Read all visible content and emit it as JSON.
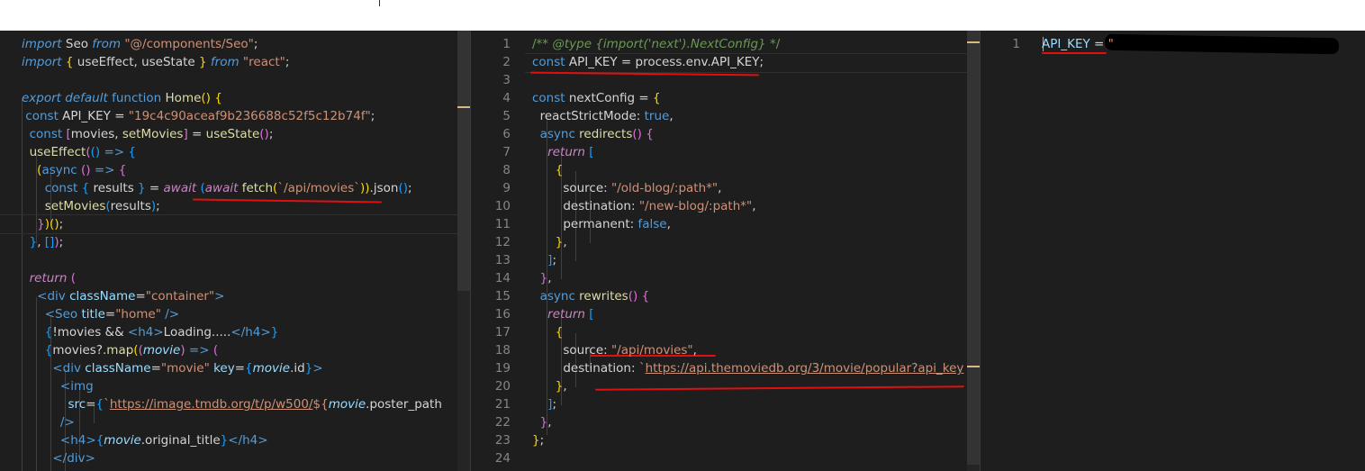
{
  "colors": {
    "background": "#1e1e1e",
    "plain": "#d4d4d4",
    "keyword": "#569cd6",
    "control": "#c586c0",
    "function": "#dcdcaa",
    "string": "#ce9178",
    "variable": "#9cdcfe",
    "comment": "#6a9955",
    "line_number": "#858585",
    "annotation": "#e01010"
  },
  "panes": [
    {
      "name": "index-js",
      "show_line_numbers": false,
      "lines": [
        [
          [
            "kw it",
            "import"
          ],
          [
            "",
            "",
            " Seo "
          ],
          [
            "kw it",
            "from"
          ],
          [
            "",
            " "
          ],
          [
            "str",
            "\"@/components/Seo\""
          ],
          [
            "",
            ";"
          ]
        ],
        [
          [
            "kw it",
            "import"
          ],
          [
            "",
            " "
          ],
          [
            "br1",
            "{"
          ],
          [
            "",
            " useEffect, useState "
          ],
          [
            "br1",
            "}"
          ],
          [
            "",
            " "
          ],
          [
            "kw it",
            "from"
          ],
          [
            "",
            " "
          ],
          [
            "str",
            "\"react\""
          ],
          [
            "",
            ";"
          ]
        ],
        [],
        [
          [
            "kw it",
            "export"
          ],
          [
            "",
            " "
          ],
          [
            "kw it",
            "default"
          ],
          [
            "",
            " "
          ],
          [
            "kw",
            "function"
          ],
          [
            "",
            " "
          ],
          [
            "fn",
            "Home"
          ],
          [
            "br1",
            "()"
          ],
          [
            "",
            " "
          ],
          [
            "br1",
            "{"
          ]
        ],
        [
          [
            "",
            "",
            " "
          ],
          [
            "kw",
            "const"
          ],
          [
            "",
            " API_KEY = "
          ],
          [
            "str",
            "\"19c4c90aceaf9b236688c52f5c12b74f\""
          ],
          [
            "",
            ";"
          ]
        ],
        [
          [
            "",
            "  "
          ],
          [
            "kw",
            "const"
          ],
          [
            "",
            " "
          ],
          [
            "br2",
            "["
          ],
          [
            "",
            "movies, "
          ],
          [
            "fn",
            "setMovies"
          ],
          [
            "br2",
            "]"
          ],
          [
            "",
            " = "
          ],
          [
            "fn",
            "useState"
          ],
          [
            "br2",
            "()"
          ],
          [
            "",
            ";"
          ]
        ],
        [
          [
            "",
            "  "
          ],
          [
            "fn",
            "useEffect"
          ],
          [
            "br2",
            "("
          ],
          [
            "br3",
            "()"
          ],
          [
            "",
            " "
          ],
          [
            "kw",
            "=>"
          ],
          [
            "",
            " "
          ],
          [
            "br3",
            "{"
          ]
        ],
        [
          [
            "",
            "    "
          ],
          [
            "br1",
            "("
          ],
          [
            "kw",
            "async"
          ],
          [
            "",
            " "
          ],
          [
            "br2",
            "()"
          ],
          [
            "",
            " "
          ],
          [
            "kw",
            "=>"
          ],
          [
            "",
            " "
          ],
          [
            "br2",
            "{"
          ]
        ],
        [
          [
            "",
            "      "
          ],
          [
            "kw",
            "const"
          ],
          [
            "",
            " "
          ],
          [
            "br3",
            "{"
          ],
          [
            "",
            " results "
          ],
          [
            "br3",
            "}"
          ],
          [
            "",
            " = "
          ],
          [
            "ctl it",
            "await"
          ],
          [
            "",
            " "
          ],
          [
            "br3",
            "("
          ],
          [
            "ctl it",
            "await"
          ],
          [
            "",
            " "
          ],
          [
            "fn",
            "fetch"
          ],
          [
            "br1",
            "("
          ],
          [
            "str",
            "`/api/movies`"
          ],
          [
            "br1",
            "))"
          ],
          [
            "",
            ".json"
          ],
          [
            "br3",
            "()"
          ],
          [
            "",
            ";"
          ]
        ],
        [
          [
            "",
            "      "
          ],
          [
            "fn",
            "setMovies"
          ],
          [
            "br3",
            "("
          ],
          [
            "",
            "results"
          ],
          [
            "br3",
            ")"
          ],
          [
            "",
            ";"
          ]
        ],
        [
          [
            "",
            "    "
          ],
          [
            "br2",
            "}"
          ],
          [
            "br1",
            ")"
          ],
          [
            "br1",
            "()"
          ],
          [
            "",
            ";"
          ]
        ],
        [
          [
            "",
            "  "
          ],
          [
            "br3",
            "}"
          ],
          [
            "",
            ", "
          ],
          [
            "br3",
            "[]"
          ],
          [
            "br2",
            ")"
          ],
          [
            "",
            ";"
          ]
        ],
        [],
        [
          [
            "",
            "  "
          ],
          [
            "ctl it",
            "return"
          ],
          [
            "",
            " "
          ],
          [
            "br2",
            "("
          ]
        ],
        [
          [
            "",
            "    "
          ],
          [
            "tag",
            "<div"
          ],
          [
            "",
            " "
          ],
          [
            "var",
            "className"
          ],
          [
            "",
            "="
          ],
          [
            "str",
            "\"container\""
          ],
          [
            "tag",
            ">"
          ]
        ],
        [
          [
            "",
            "      "
          ],
          [
            "tag",
            "<Seo"
          ],
          [
            "",
            " "
          ],
          [
            "var",
            "title"
          ],
          [
            "",
            "="
          ],
          [
            "str",
            "\"home\""
          ],
          [
            "",
            " "
          ],
          [
            "tag",
            "/>"
          ]
        ],
        [
          [
            "",
            "      "
          ],
          [
            "br3",
            "{"
          ],
          [
            "",
            "!movies && "
          ],
          [
            "tag",
            "<h4>"
          ],
          [
            "",
            "Loading....."
          ],
          [
            "tag",
            "</h4>"
          ],
          [
            "br3",
            "}"
          ]
        ],
        [
          [
            "",
            "      "
          ],
          [
            "br3",
            "{"
          ],
          [
            "",
            "movies?."
          ],
          [
            "fn",
            "map"
          ],
          [
            "br1",
            "("
          ],
          [
            "br2",
            "("
          ],
          [
            "var it",
            "movie"
          ],
          [
            "br2",
            ")"
          ],
          [
            "",
            " "
          ],
          [
            "kw",
            "=>"
          ],
          [
            "",
            " "
          ],
          [
            "br2",
            "("
          ]
        ],
        [
          [
            "",
            "        "
          ],
          [
            "tag",
            "<div"
          ],
          [
            "",
            " "
          ],
          [
            "var",
            "className"
          ],
          [
            "",
            "="
          ],
          [
            "str",
            "\"movie\""
          ],
          [
            "",
            " "
          ],
          [
            "var",
            "key"
          ],
          [
            "",
            "="
          ],
          [
            "br3",
            "{"
          ],
          [
            "var it",
            "movie"
          ],
          [
            "",
            ".id"
          ],
          [
            "br3",
            "}"
          ],
          [
            "tag",
            ">"
          ]
        ],
        [
          [
            "",
            "          "
          ],
          [
            "tag",
            "<img"
          ]
        ],
        [
          [
            "",
            "            "
          ],
          [
            "var",
            "src"
          ],
          [
            "",
            "="
          ],
          [
            "br3",
            "{"
          ],
          [
            "str",
            "`"
          ],
          [
            "str ul",
            "https://image.tmdb.org/t/p/w500/"
          ],
          [
            "str",
            "${"
          ],
          [
            "var it",
            "movie"
          ],
          [
            "",
            ".poster_path"
          ]
        ],
        [
          [
            "",
            "          "
          ],
          [
            "tag",
            "/>"
          ]
        ],
        [
          [
            "",
            "          "
          ],
          [
            "tag",
            "<h4>"
          ],
          [
            "br3",
            "{"
          ],
          [
            "var it",
            "movie"
          ],
          [
            "",
            ".original_title"
          ],
          [
            "br3",
            "}"
          ],
          [
            "tag",
            "</h4>"
          ]
        ],
        [
          [
            "",
            "        "
          ],
          [
            "tag",
            "</div>"
          ]
        ]
      ]
    },
    {
      "name": "next-config-js",
      "show_line_numbers": true,
      "line_numbers": [
        "1",
        "2",
        "3",
        "4",
        "5",
        "6",
        "7",
        "8",
        "9",
        "10",
        "11",
        "12",
        "13",
        "14",
        "15",
        "16",
        "17",
        "18",
        "19",
        "20",
        "21",
        "22",
        "23",
        "24"
      ],
      "lines": [
        [
          [
            "cmt",
            "/** "
          ],
          [
            "cmt it",
            "@type"
          ],
          [
            "cmt",
            " "
          ],
          [
            "cmt it",
            "{import('next').NextConfig}"
          ],
          [
            "cmt",
            " */"
          ]
        ],
        [
          [
            "kw",
            "const"
          ],
          [
            "",
            " API_KEY = process.env.API_KEY;"
          ]
        ],
        [],
        [
          [
            "kw",
            "const"
          ],
          [
            "",
            " nextConfig = "
          ],
          [
            "br1",
            "{"
          ]
        ],
        [
          [
            "",
            "  reactStrictMode: "
          ],
          [
            "kw",
            "true"
          ],
          [
            "",
            ","
          ]
        ],
        [
          [
            "",
            "  "
          ],
          [
            "kw",
            "async"
          ],
          [
            "",
            " "
          ],
          [
            "fn",
            "redirects"
          ],
          [
            "br2",
            "()"
          ],
          [
            "",
            " "
          ],
          [
            "br2",
            "{"
          ]
        ],
        [
          [
            "",
            "    "
          ],
          [
            "ctl it",
            "return"
          ],
          [
            "",
            " "
          ],
          [
            "br3",
            "["
          ]
        ],
        [
          [
            "",
            "      "
          ],
          [
            "br1",
            "{"
          ]
        ],
        [
          [
            "",
            "        source: "
          ],
          [
            "str",
            "\"/old-blog/:path*\""
          ],
          [
            "",
            ","
          ]
        ],
        [
          [
            "",
            "        destination: "
          ],
          [
            "str",
            "\"/new-blog/:path*\""
          ],
          [
            "",
            ","
          ]
        ],
        [
          [
            "",
            "        permanent: "
          ],
          [
            "kw",
            "false"
          ],
          [
            "",
            ","
          ]
        ],
        [
          [
            "",
            "      "
          ],
          [
            "br1",
            "}"
          ],
          [
            "",
            ","
          ]
        ],
        [
          [
            "",
            "    "
          ],
          [
            "br3",
            "]"
          ],
          [
            "",
            ";"
          ]
        ],
        [
          [
            "",
            "  "
          ],
          [
            "br2",
            "}"
          ],
          [
            "",
            ","
          ]
        ],
        [
          [
            "",
            "  "
          ],
          [
            "kw",
            "async"
          ],
          [
            "",
            " "
          ],
          [
            "fn",
            "rewrites"
          ],
          [
            "br2",
            "()"
          ],
          [
            "",
            " "
          ],
          [
            "br2",
            "{"
          ]
        ],
        [
          [
            "",
            "    "
          ],
          [
            "ctl it",
            "return"
          ],
          [
            "",
            " "
          ],
          [
            "br3",
            "["
          ]
        ],
        [
          [
            "",
            "      "
          ],
          [
            "br1",
            "{"
          ]
        ],
        [
          [
            "",
            "        source: "
          ],
          [
            "str",
            "\"/api/movies\""
          ],
          [
            "",
            ","
          ]
        ],
        [
          [
            "",
            "        destination: "
          ],
          [
            "str",
            "`"
          ],
          [
            "str ul",
            "https://api.themoviedb.org/3/movie/popular?api_key"
          ]
        ],
        [
          [
            "",
            "      "
          ],
          [
            "br1",
            "}"
          ],
          [
            "",
            ","
          ]
        ],
        [
          [
            "",
            "    "
          ],
          [
            "br3",
            "]"
          ],
          [
            "",
            ";"
          ]
        ],
        [
          [
            "",
            "  "
          ],
          [
            "br2",
            "}"
          ],
          [
            "",
            ","
          ]
        ],
        [
          [
            "br1",
            "}"
          ],
          [
            "",
            ";"
          ]
        ],
        []
      ]
    },
    {
      "name": "env-file",
      "show_line_numbers": true,
      "line_numbers": [
        "1"
      ],
      "lines": [
        [
          [
            "var",
            "API_KEY"
          ],
          [
            "",
            "",
            " = "
          ],
          [
            "str",
            "\""
          ]
        ]
      ]
    }
  ]
}
